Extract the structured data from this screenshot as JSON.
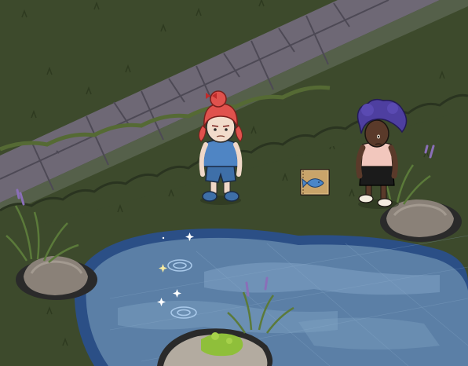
{
  "scene": {
    "colors": {
      "grass": "#3d4a2c",
      "grass_light": "#48562f",
      "grass_edge": "#556a34",
      "path": "#6e6875",
      "path_dark": "#56515e",
      "path_line": "#4d4955",
      "water": "#5b7fa6",
      "water_light": "#7fa3c4",
      "water_edge": "#2b4f86",
      "rock": "#8a8178",
      "rock_dark": "#4f4944",
      "moss": "#8fbf3a",
      "hair_red": "#e0524d",
      "outfit_blue": "#3e6fa8",
      "hair_purple": "#4e3fa0",
      "skin_dark": "#5a3a2a",
      "top_pink": "#f2c7bd",
      "sign": "#c9a46a",
      "fish": "#4a86c8"
    }
  },
  "characters": [
    {
      "id": "red-hair-player"
    },
    {
      "id": "purple-afro-npc"
    }
  ],
  "objects": [
    {
      "id": "fishing-sign",
      "icon": "fish-icon"
    },
    {
      "id": "pond"
    },
    {
      "id": "rock-left"
    },
    {
      "id": "rock-right"
    },
    {
      "id": "mossy-rock"
    },
    {
      "id": "lavender-plants"
    },
    {
      "id": "water-sparkles"
    }
  ]
}
